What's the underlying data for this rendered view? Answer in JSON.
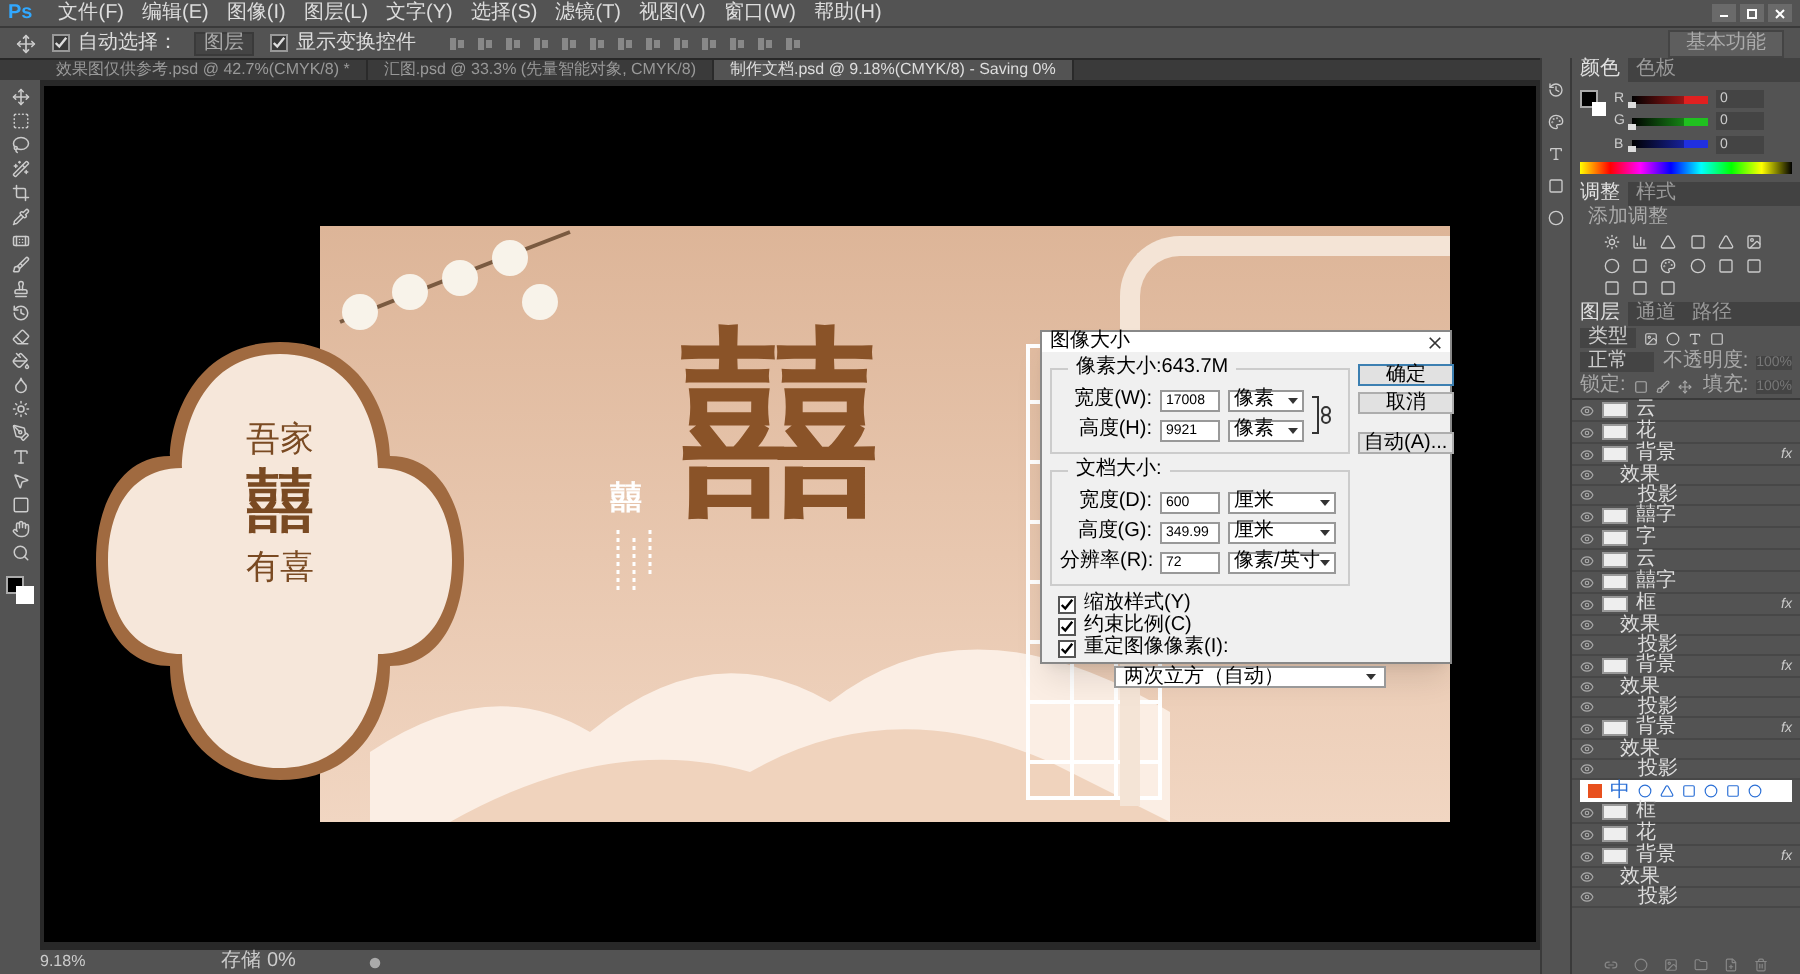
{
  "app_logo": "Ps",
  "menu": [
    "文件(F)",
    "编辑(E)",
    "图像(I)",
    "图层(L)",
    "文字(Y)",
    "选择(S)",
    "滤镜(T)",
    "视图(V)",
    "窗口(W)",
    "帮助(H)"
  ],
  "options": {
    "auto_select": {
      "label": "自动选择：",
      "checked": true
    },
    "target": "图层",
    "show_transform": {
      "label": "显示变换控件",
      "checked": true
    },
    "workspace": "基本功能"
  },
  "tabs": [
    {
      "label": "效果图仅供参考.psd @ 42.7%(CMYK/8) *",
      "selected": false
    },
    {
      "label": "汇图.psd @ 33.3% (先量智能对象, CMYK/8)",
      "selected": false
    },
    {
      "label": "制作文档.psd @ 9.18%(CMYK/8) - Saving 0%",
      "selected": true
    }
  ],
  "artwork": {
    "big_char": "囍",
    "small_char": "囍",
    "badge_lines": [
      "吾家",
      "囍",
      "有喜"
    ]
  },
  "dialog": {
    "title": "图像大小",
    "pixel_group": {
      "title": "像素大小:643.7M",
      "rows": [
        {
          "label": "宽度(W):",
          "value": "17008",
          "unit": "像素"
        },
        {
          "label": "高度(H):",
          "value": "9921",
          "unit": "像素"
        }
      ]
    },
    "doc_group": {
      "title": "文档大小:",
      "rows": [
        {
          "label": "宽度(D):",
          "value": "600",
          "unit": "厘米"
        },
        {
          "label": "高度(G):",
          "value": "349.99",
          "unit": "厘米"
        },
        {
          "label": "分辨率(R):",
          "value": "72",
          "unit": "像素/英寸"
        }
      ]
    },
    "buttons": [
      "确定",
      "取消",
      "自动(A)..."
    ],
    "checkboxes": [
      {
        "label": "缩放样式(Y)",
        "checked": true
      },
      {
        "label": "约束比例(C)",
        "checked": true
      },
      {
        "label": "重定图像像素(I):",
        "checked": true
      }
    ],
    "resample": "两次立方（自动）"
  },
  "color_panel": {
    "tabs": [
      {
        "label": "颜色",
        "selected": true
      },
      {
        "label": "色板",
        "selected": false
      }
    ],
    "channels": [
      {
        "name": "R",
        "value": "0",
        "level": 0,
        "color": "#e02020"
      },
      {
        "name": "G",
        "value": "0",
        "level": 0,
        "color": "#20c020"
      },
      {
        "name": "B",
        "value": "0",
        "level": 0,
        "color": "#2030e0"
      }
    ]
  },
  "adjust_panel": {
    "tabs": [
      {
        "label": "调整",
        "selected": true
      },
      {
        "label": "样式",
        "selected": false
      }
    ],
    "title": "添加调整"
  },
  "layers_panel": {
    "tabs": [
      {
        "label": "图层",
        "selected": true
      },
      {
        "label": "通道",
        "selected": false
      },
      {
        "label": "路径",
        "selected": false
      }
    ],
    "filter": "类型",
    "blend": "正常",
    "opacity_label": "不透明度:",
    "opacity": "100%",
    "lock_label": "锁定:",
    "fill_label": "填充:",
    "fill": "100%",
    "layers": [
      {
        "kind": "layer",
        "name": "云"
      },
      {
        "kind": "layer",
        "name": "花"
      },
      {
        "kind": "layer",
        "name": "背景",
        "badge": "fx",
        "children": [
          {
            "name": "效果",
            "children": [
              {
                "name": "投影"
              }
            ]
          }
        ]
      },
      {
        "kind": "layer",
        "name": "囍字"
      },
      {
        "kind": "layer",
        "name": "字"
      },
      {
        "kind": "layer",
        "name": "云"
      },
      {
        "kind": "layer",
        "name": "囍字"
      },
      {
        "kind": "layer",
        "name": "框",
        "badge": "fx",
        "children": [
          {
            "name": "效果",
            "children": [
              {
                "name": "投影"
              }
            ]
          }
        ]
      },
      {
        "kind": "layer",
        "name": "背景",
        "badge": "fx",
        "children": [
          {
            "name": "效果",
            "children": [
              {
                "name": "投影"
              }
            ]
          }
        ]
      },
      {
        "kind": "layer",
        "name": "背景",
        "badge": "fx",
        "children": [
          {
            "name": "效果",
            "children": [
              {
                "name": "投影"
              }
            ]
          }
        ]
      },
      {
        "kind": "ime",
        "label": "中"
      },
      {
        "kind": "layer",
        "name": "框"
      },
      {
        "kind": "layer",
        "name": "花"
      },
      {
        "kind": "layer",
        "name": "背景",
        "badge": "fx",
        "children": [
          {
            "name": "效果",
            "children": [
              {
                "name": "投影"
              }
            ]
          }
        ]
      }
    ]
  },
  "status_bar": {
    "zoom": "9.18%",
    "info": "存储 0%"
  }
}
